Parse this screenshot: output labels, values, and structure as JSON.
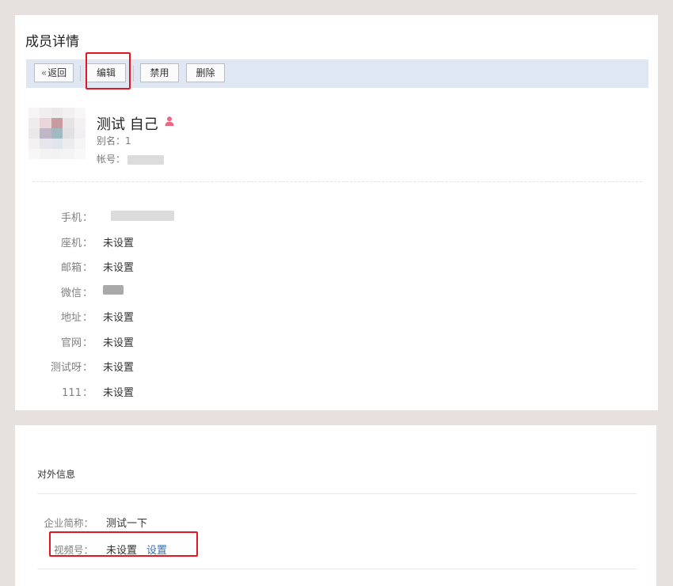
{
  "page": {
    "title": "成员详情"
  },
  "toolbar": {
    "back_chevron": "«",
    "back_label": "返回",
    "edit_label": "编辑",
    "disable_label": "禁用",
    "delete_label": "删除"
  },
  "member": {
    "name": "测试 自己",
    "alias_label": "别名：",
    "alias_value": "1",
    "account_label": "帐号："
  },
  "fields": [
    {
      "label": "手机",
      "value": ""
    },
    {
      "label": "座机",
      "value": "未设置"
    },
    {
      "label": "邮箱",
      "value": "未设置"
    },
    {
      "label": "微信",
      "value": ""
    },
    {
      "label": "地址",
      "value": "未设置"
    },
    {
      "label": "官网",
      "value": "未设置"
    },
    {
      "label": "测试呀",
      "value": "未设置"
    },
    {
      "label": "111",
      "value": "未设置"
    }
  ],
  "colon": "：",
  "external": {
    "section_title": "对外信息",
    "company_short_label": "企业简称：",
    "company_short_value": "测试一下",
    "channel_label": "视频号：",
    "channel_value": "未设置",
    "channel_action": "设置"
  },
  "colors": {
    "highlight": "#e6161f",
    "link": "#3a6fa6",
    "toolbar_bg": "#dee7f2",
    "person_icon": "#e86a82"
  }
}
